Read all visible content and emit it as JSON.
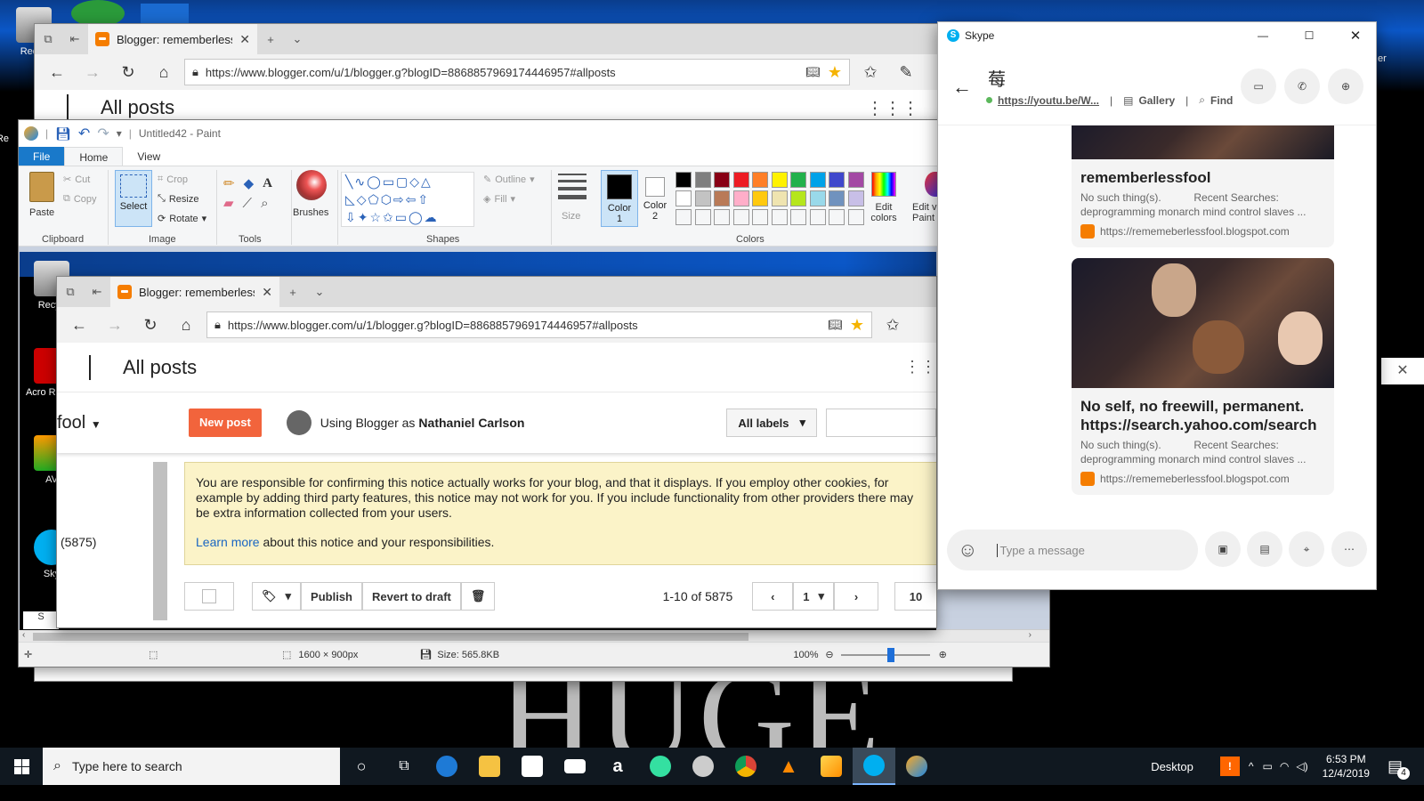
{
  "desktop": {
    "icons": [
      {
        "label": "Recyc"
      },
      {
        "label": "Re"
      },
      {
        "label": "Recyc"
      },
      {
        "label": "Acro Reade"
      },
      {
        "label": "AV"
      },
      {
        "label": "Sky"
      },
      {
        "label": "S"
      }
    ],
    "right_edge_fragment": "er",
    "background_text": "HUGE"
  },
  "back_edge": {
    "tab_title": "Blogger: rememberlessf",
    "url": "https://www.blogger.com/u/1/blogger.g?blogID=8868857969174446957#allposts",
    "page_title": "All posts"
  },
  "paint": {
    "title": "Untitled42 - Paint",
    "ribbon_tabs": [
      "File",
      "Home",
      "View"
    ],
    "clipboard": {
      "paste": "Paste",
      "cut": "Cut",
      "copy": "Copy",
      "label": "Clipboard"
    },
    "image": {
      "select": "Select",
      "crop": "Crop",
      "resize": "Resize",
      "rotate": "Rotate",
      "label": "Image"
    },
    "tools": {
      "label": "Tools"
    },
    "brushes": "Brushes",
    "shapes": {
      "outline": "Outline",
      "fill": "Fill",
      "label": "Shapes"
    },
    "size": "Size",
    "color1": "Color 1",
    "color2": "Color 2",
    "colors_label": "Colors",
    "edit_colors": "Edit colors",
    "edit_with": "Edit v Paint",
    "palette": [
      "#000000",
      "#7f7f7f",
      "#880015",
      "#ed1c24",
      "#ff7f27",
      "#fff200",
      "#22b14c",
      "#00a2e8",
      "#3f48cc",
      "#a349a4",
      "#ffffff",
      "#c3c3c3",
      "#b97a57",
      "#ffaec9",
      "#ffc90e",
      "#efe4b0",
      "#b5e61d",
      "#99d9ea",
      "#7092be",
      "#c8bfe7"
    ],
    "status": {
      "dimensions": "1600 × 900px",
      "size": "Size: 565.8KB",
      "zoom": "100%"
    }
  },
  "inner_edge": {
    "tab_title": "Blogger: rememberlessf",
    "url": "https://www.blogger.com/u/1/blogger.g?blogID=8868857969174446957#allposts",
    "page_title": "All posts",
    "blog_name_fragment": "fool",
    "new_post": "New post",
    "using_as": "Using Blogger as",
    "user_name": "Nathaniel Carlson",
    "all_labels": "All labels",
    "notice_text": "You are responsible for confirming this notice actually works for your blog, and that it displays. If you employ other cookies, for example by adding third party features, this notice may not work for you. If you include functionality from other providers there may be extra information collected from your users.",
    "learn_more": "Learn more",
    "learn_more_rest": "about this notice and your responsibilities.",
    "post_count": "(5875)",
    "publish": "Publish",
    "revert": "Revert to draft",
    "range": "1-10 of 5875",
    "page": "1",
    "per_page": "10"
  },
  "skype": {
    "title": "Skype",
    "contact_glyph": "莓",
    "link": "https://youtu.be/W...",
    "gallery": "Gallery",
    "find": "Find",
    "cards": [
      {
        "title": "rememberlessfool",
        "desc_left": "No such thing(s).",
        "desc_right": "Recent Searches:",
        "desc_line2": "deprogramming monarch mind control slaves ...",
        "source": "https://rememeberlessfool.blogspot.com"
      },
      {
        "title": "No self, no freewill, permanent. https://search.yahoo.com/search",
        "desc_left": "No such thing(s).",
        "desc_right": "Recent Searches:",
        "desc_line2": "deprogramming monarch mind control slaves ...",
        "source": "https://rememeberlessfool.blogspot.com"
      }
    ],
    "message_placeholder": "Type a message"
  },
  "taskbar": {
    "search_placeholder": "Type here to search",
    "desktop_label": "Desktop",
    "time": "6:53 PM",
    "date": "12/4/2019",
    "notification_count": "4"
  }
}
